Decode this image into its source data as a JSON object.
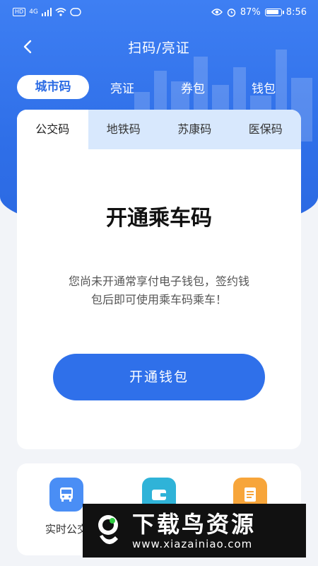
{
  "status_bar": {
    "network_tag": "HD",
    "signal": "4G",
    "battery_percent": "87%",
    "time": "8:56",
    "icons": [
      "hd-icon",
      "signal-icon",
      "wifi-icon",
      "nfc-icon",
      "eye-icon",
      "alarm-icon",
      "battery-icon"
    ]
  },
  "nav": {
    "title": "扫码/亮证",
    "back_icon": "chevron-left-icon"
  },
  "top_tabs": [
    {
      "label": "城市码",
      "active": true
    },
    {
      "label": "亮证",
      "active": false
    },
    {
      "label": "券包",
      "active": false
    },
    {
      "label": "钱包",
      "active": false
    }
  ],
  "sub_tabs": [
    {
      "label": "公交码",
      "active": true
    },
    {
      "label": "地铁码",
      "active": false
    },
    {
      "label": "苏康码",
      "active": false
    },
    {
      "label": "医保码",
      "active": false
    }
  ],
  "card": {
    "title": "开通乘车码",
    "desc_line1": "您尚未开通常享付电子钱包，签约钱",
    "desc_line2": "包后即可使用乘车码乘车！",
    "button": "开通钱包"
  },
  "services": [
    {
      "label": "实时公交",
      "icon": "bus-icon",
      "color": "#4a8ef5"
    },
    {
      "label": "",
      "icon": "wallet-icon",
      "color": "#2fb3d8"
    },
    {
      "label": "",
      "icon": "document-icon",
      "color": "#f7a53a"
    }
  ],
  "watermark": {
    "title": "下载鸟资源",
    "url": "www.xiazainiao.com"
  },
  "colors": {
    "primary": "#2f70ea",
    "subtab_bg": "#d8e8fd",
    "page_bg": "#f2f4f8"
  }
}
